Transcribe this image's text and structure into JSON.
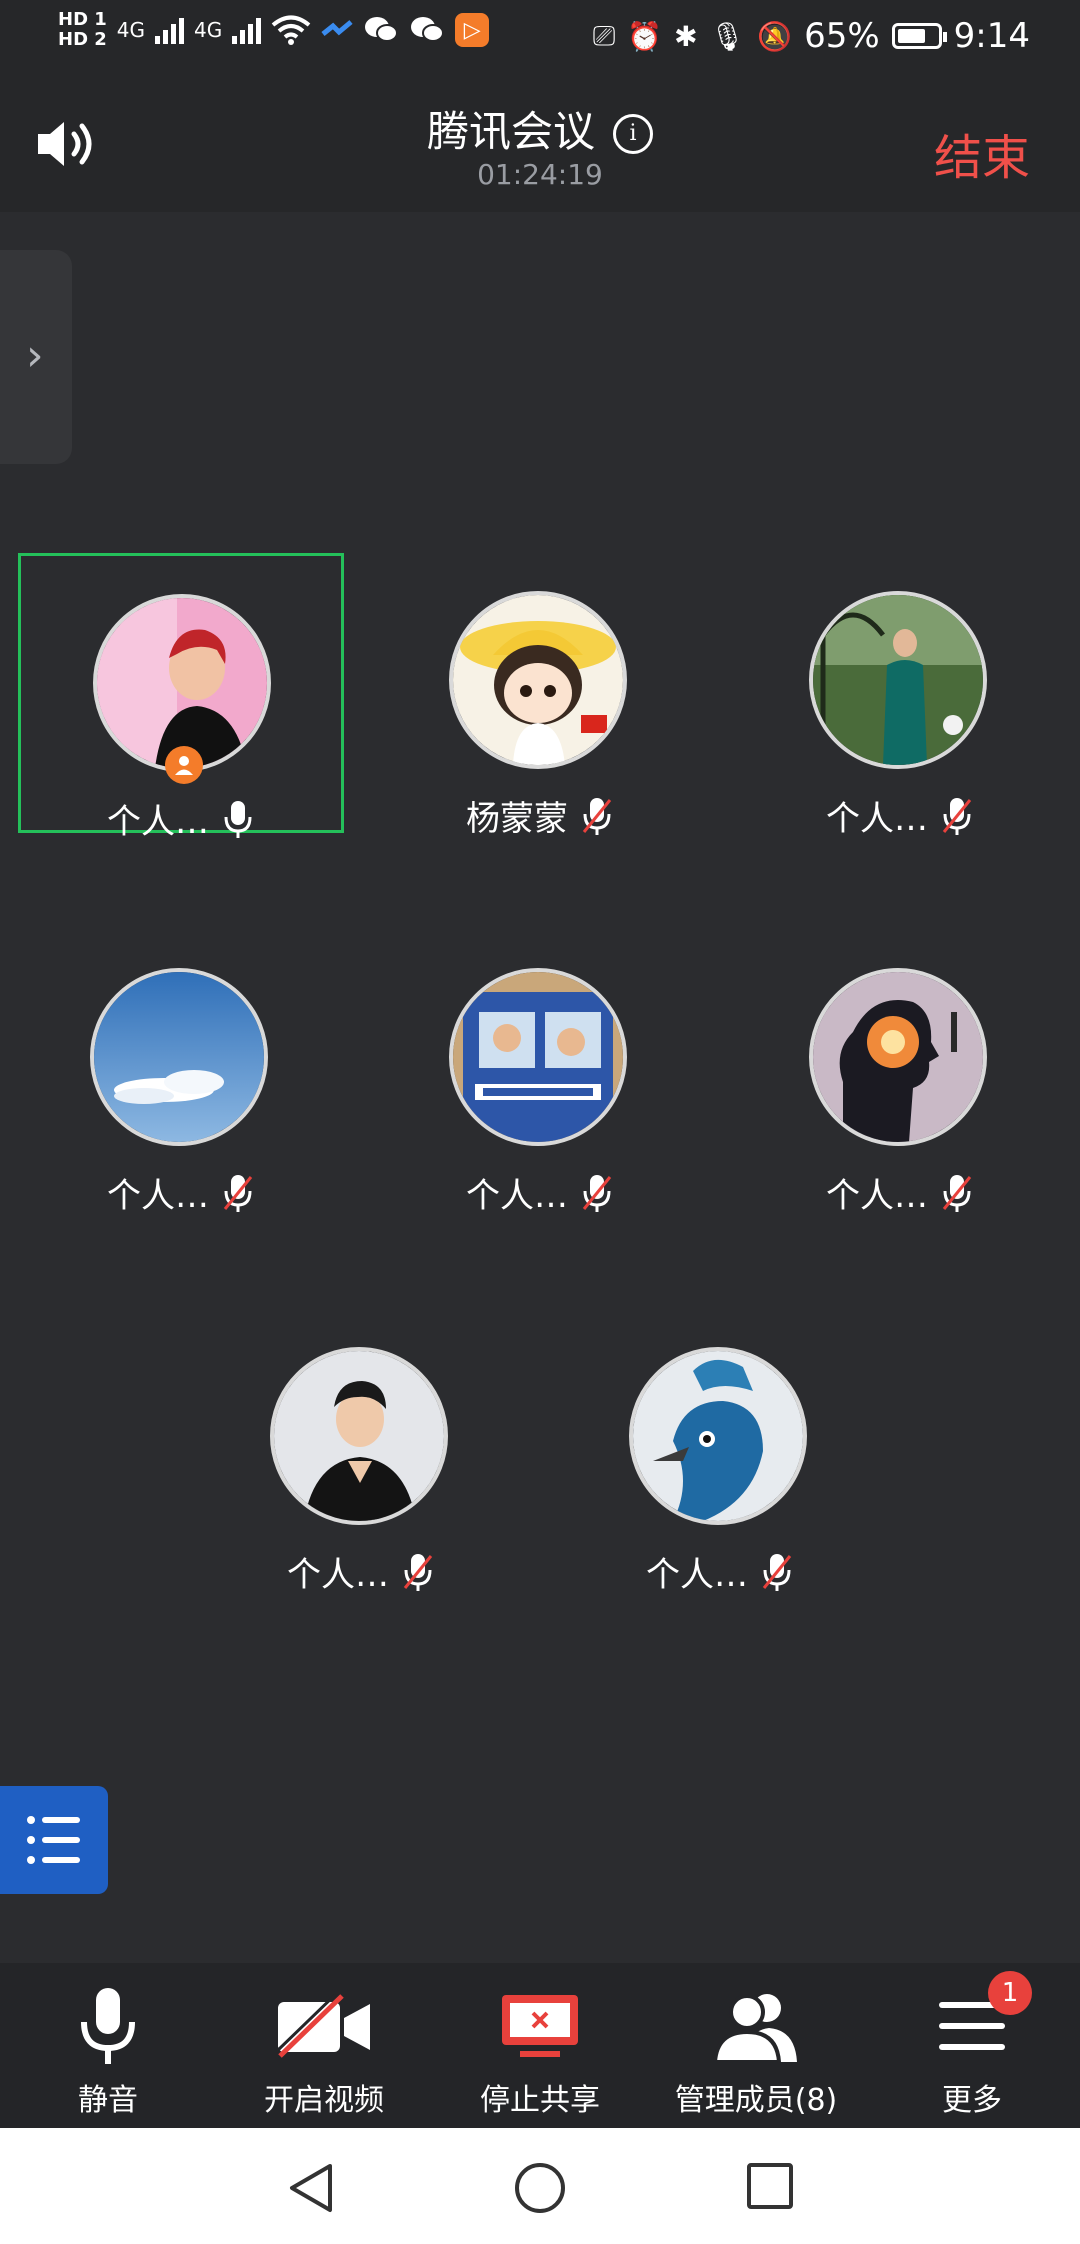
{
  "status_bar": {
    "hd1": "HD 1",
    "hd2": "HD 2",
    "network1": "4G",
    "network2": "4G",
    "battery_percent": "65%",
    "time": "9:14",
    "app_badge": "▷"
  },
  "header": {
    "title": "腾讯会议",
    "info_glyph": "i",
    "timer": "01:24:19",
    "end_label": "结束"
  },
  "side_panel": {
    "toggle_glyph": "›"
  },
  "participants": [
    {
      "name": "个人…",
      "muted": false,
      "host": true,
      "active": true,
      "avatar": "woman-red-hair-pink-banner"
    },
    {
      "name": "杨蒙蒙",
      "muted": true,
      "host": false,
      "active": false,
      "avatar": "cartoon-girl-yellow-hat"
    },
    {
      "name": "个人…",
      "muted": true,
      "host": false,
      "active": false,
      "avatar": "woman-green-dress-garden"
    },
    {
      "name": "个人…",
      "muted": true,
      "host": false,
      "active": false,
      "avatar": "blue-sky-cloud"
    },
    {
      "name": "个人…",
      "muted": true,
      "host": false,
      "active": false,
      "avatar": "kids-toy-police-car"
    },
    {
      "name": "个人…",
      "muted": true,
      "host": false,
      "active": false,
      "avatar": "silhouette-head-galaxy"
    },
    {
      "name": "个人…",
      "muted": true,
      "host": false,
      "active": false,
      "avatar": "woman-black-suit"
    },
    {
      "name": "个人…",
      "muted": true,
      "host": false,
      "active": false,
      "avatar": "peacock-painting"
    }
  ],
  "toolbar": {
    "mute_label": "静音",
    "video_label": "开启视频",
    "share_label": "停止共享",
    "members_label": "管理成员(8)",
    "more_label": "更多",
    "more_badge": "1"
  },
  "colors": {
    "background": "#2b2c2f",
    "bar": "#242528",
    "end_red": "#f0504a",
    "active_green": "#24c05a",
    "host_orange": "#f47c2a",
    "list_blue": "#1f5fc3",
    "share_red": "#e8413c"
  }
}
